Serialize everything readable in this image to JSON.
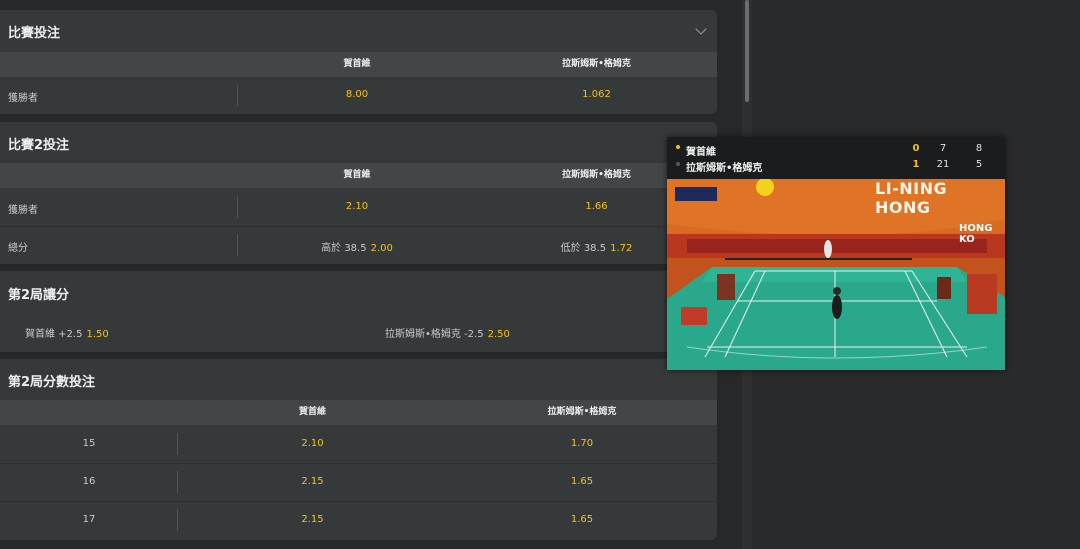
{
  "match_bet": {
    "title": "比賽投注",
    "col1": "賀首維",
    "col2": "拉斯姆斯•格姆克",
    "winner_label": "獲勝者",
    "winner_odds1": "8.00",
    "winner_odds2": "1.062"
  },
  "match2_bet": {
    "title": "比賽2投注",
    "col1": "賀首維",
    "col2": "拉斯姆斯•格姆克",
    "winner_label": "獲勝者",
    "winner_odds1": "2.10",
    "winner_odds2": "1.66",
    "total_label": "總分",
    "over_label": "高於 38.5",
    "over_odds": "2.00",
    "under_label": "低於 38.5",
    "under_odds": "1.72"
  },
  "game2_handicap": {
    "title": "第2局讓分",
    "opt1_label": "賀首維 +2.5",
    "opt1_odds": "1.50",
    "opt2_label": "拉斯姆斯•格姆克 -2.5",
    "opt2_odds": "2.50"
  },
  "game2_points": {
    "title": "第2局分數投注",
    "col1": "賀首維",
    "col2": "拉斯姆斯•格姆克",
    "rows": [
      {
        "points": "15",
        "odds1": "2.10",
        "odds2": "1.70"
      },
      {
        "points": "16",
        "odds1": "2.15",
        "odds2": "1.65"
      },
      {
        "points": "17",
        "odds1": "2.15",
        "odds2": "1.65"
      }
    ]
  },
  "scoreboard": {
    "players": [
      {
        "name": "賀首維",
        "current": "0",
        "g1": "7",
        "g2": "8",
        "serving": true
      },
      {
        "name": "拉斯姆斯•格姆克",
        "current": "1",
        "g1": "21",
        "g2": "5",
        "serving": false
      }
    ],
    "banner": "LI-NING HONG",
    "banner2": "HONG KO"
  },
  "colors": {
    "odds": "#f3c316",
    "court": "#2aa88b",
    "arena_orange": "#d86a22"
  }
}
